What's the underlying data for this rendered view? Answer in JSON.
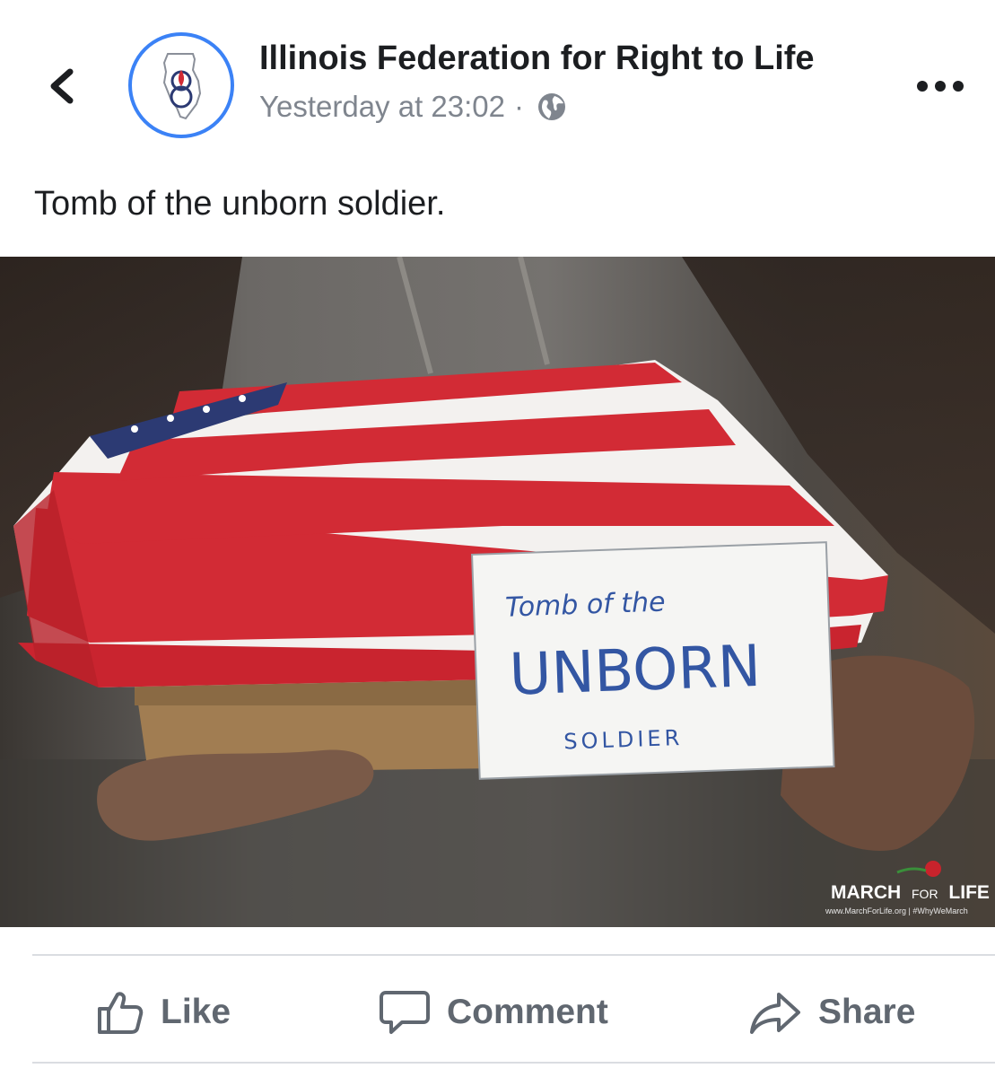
{
  "header": {
    "page_name": "Illinois Federation for Right to Life",
    "timestamp": "Yesterday at 23:02",
    "separator": "·",
    "icons": {
      "back": "chevron-left-icon",
      "audience": "globe-icon",
      "more": "more-options-icon"
    }
  },
  "post": {
    "text": "Tomb of the unborn soldier."
  },
  "photo": {
    "sign_line1": "Tomb of the",
    "sign_line2": "UNBORN",
    "sign_line3": "SOLDIER",
    "watermark_title_a": "MARCH",
    "watermark_title_b": "FOR",
    "watermark_title_c": "LIFE",
    "watermark_sub": "www.MarchForLife.org | #WhyWeMarch"
  },
  "actions": {
    "like_label": "Like",
    "comment_label": "Comment",
    "share_label": "Share"
  },
  "colors": {
    "accent_ring": "#3b82f6",
    "text_primary": "#1c1e21",
    "text_secondary": "#7f858e",
    "action_text": "#606770",
    "flag_red": "#d22b35",
    "flag_blue": "#2c3a73"
  }
}
